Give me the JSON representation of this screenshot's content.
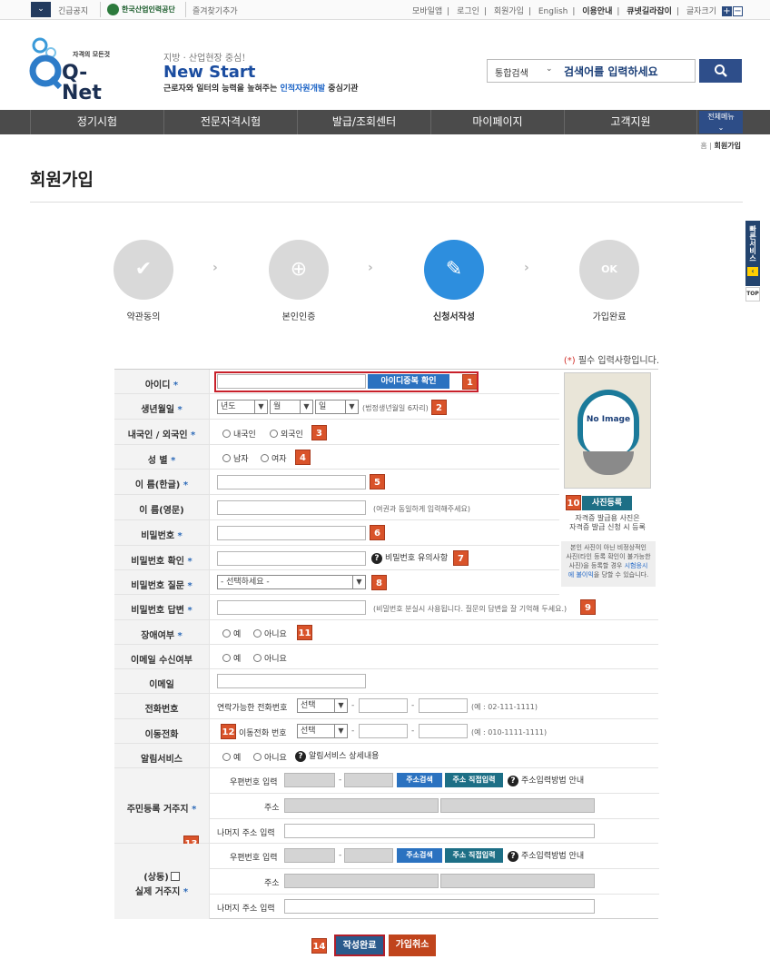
{
  "topbar": {
    "notice": "긴급공지",
    "org": "한국산업인력공단",
    "favorite": "즐겨찾기추가",
    "links": [
      "모바일앱",
      "로그인",
      "회원가입",
      "English"
    ],
    "bold_links": [
      "이용안내",
      "큐넷길라잡이"
    ],
    "font_size": "글자크기",
    "plus": "+",
    "minus": "−"
  },
  "logo": {
    "small": "자격의 모든것",
    "big": "Q-Net"
  },
  "slogan": {
    "line1": "지방 · 산업현장 중심!",
    "line2": "New Start",
    "line3_pre": "근로자와 일터의 능력을 높혀주는 ",
    "line3_hl": "인적자원개발",
    "line3_post": " 중심기관"
  },
  "search": {
    "scope": "통합검색",
    "placeholder": "검색어를 입력하세요"
  },
  "gnb": {
    "items": [
      "정기시험",
      "전문자격시험",
      "발급/조회센터",
      "마이페이지",
      "고객지원"
    ],
    "all_menu": "전체메뉴"
  },
  "breadcrumb": {
    "home": "홈",
    "current": "회원가입"
  },
  "page_title": "회원가입",
  "quick": {
    "label": "빠른서비스",
    "top": "TOP"
  },
  "steps": [
    "약관동의",
    "본인인증",
    "신청서작성",
    "가입완료"
  ],
  "required_note": {
    "mark": "(*)",
    "text": " 필수 입력사항입니다."
  },
  "required_mark": "*",
  "form": {
    "id": {
      "label": "아이디",
      "button": "아이디중복 확인",
      "num": "1"
    },
    "birth": {
      "label": "생년월일",
      "year": "년도",
      "month": "월",
      "day": "일",
      "hint": "(법정생년월일 6자리)",
      "num": "2"
    },
    "nation": {
      "label": "내국인 / 외국인",
      "opt1": "내국인",
      "opt2": "외국인",
      "num": "3"
    },
    "gender": {
      "label": "성 별",
      "opt1": "남자",
      "opt2": "여자",
      "num": "4"
    },
    "name_kr": {
      "label": "이 름(한글)",
      "num": "5"
    },
    "name_en": {
      "label": "이 름(영문)",
      "hint": "(여권과 동일하게 입력해주세요)"
    },
    "pw": {
      "label": "비밀번호",
      "num": "6"
    },
    "pw_confirm": {
      "label": "비밀번호 확인",
      "help": "비밀번호 유의사항",
      "num": "7"
    },
    "pw_question": {
      "label": "비밀번호 질문",
      "placeholder": "- 선택하세요 -",
      "num": "8"
    },
    "pw_answer": {
      "label": "비밀번호 답변",
      "hint": "(비밀번호 분실시 사용됩니다. 질문의 답변을 잘 기억해 두세요.)",
      "num": "9"
    },
    "disability": {
      "label": "장애여부",
      "opt1": "예",
      "opt2": "아니요",
      "num": "11"
    },
    "email_recv": {
      "label": "이메일 수신여부",
      "opt1": "예",
      "opt2": "아니요"
    },
    "email": {
      "label": "이메일"
    },
    "phone": {
      "label": "전화번호",
      "sub": "연락가능한 전화번호",
      "select": "선택",
      "hint": "(예 : 02-111-1111)"
    },
    "mobile": {
      "label": "이동전화",
      "sub": "이동전화 번호",
      "select": "선택",
      "hint": "(예 : 010-1111-1111)",
      "num": "12"
    },
    "alarm": {
      "label": "알림서비스",
      "opt1": "예",
      "opt2": "아니요",
      "help": "알림서비스 상세내용"
    },
    "addr_reg": {
      "label": "주민등록 거주지",
      "zip": "우편번호 입력",
      "search": "주소검색",
      "direct": "주소 직접입력",
      "help": "주소입력방법 안내",
      "addr": "주소",
      "rest": "나머지 주소 입력",
      "num": "13"
    },
    "addr_real": {
      "label_pre": "(상동)",
      "label": "실제 거주지",
      "zip": "우편번호 입력",
      "search": "주소검색",
      "direct": "주소 직접입력",
      "help": "주소입력방법 안내",
      "addr": "주소",
      "rest": "나머지 주소 입력"
    },
    "dash": "-"
  },
  "photo": {
    "noimage": "No Image",
    "button": "사진등록",
    "num": "10",
    "hint1": "자격증 발급용 사진은",
    "hint2": "자격증 발급 신청 시 등록",
    "note1": "본인 사진이 아닌 비정상적인",
    "note2": "사진(타인 등록 확인이 불가능한",
    "note3": "사진)을 등록할 경우 ",
    "note_hl": "시험응시",
    "note4": "에 불이익",
    "note5": "을 당할 수 있습니다."
  },
  "buttons": {
    "submit": "작성완료",
    "cancel": "가입취소",
    "num": "14"
  }
}
